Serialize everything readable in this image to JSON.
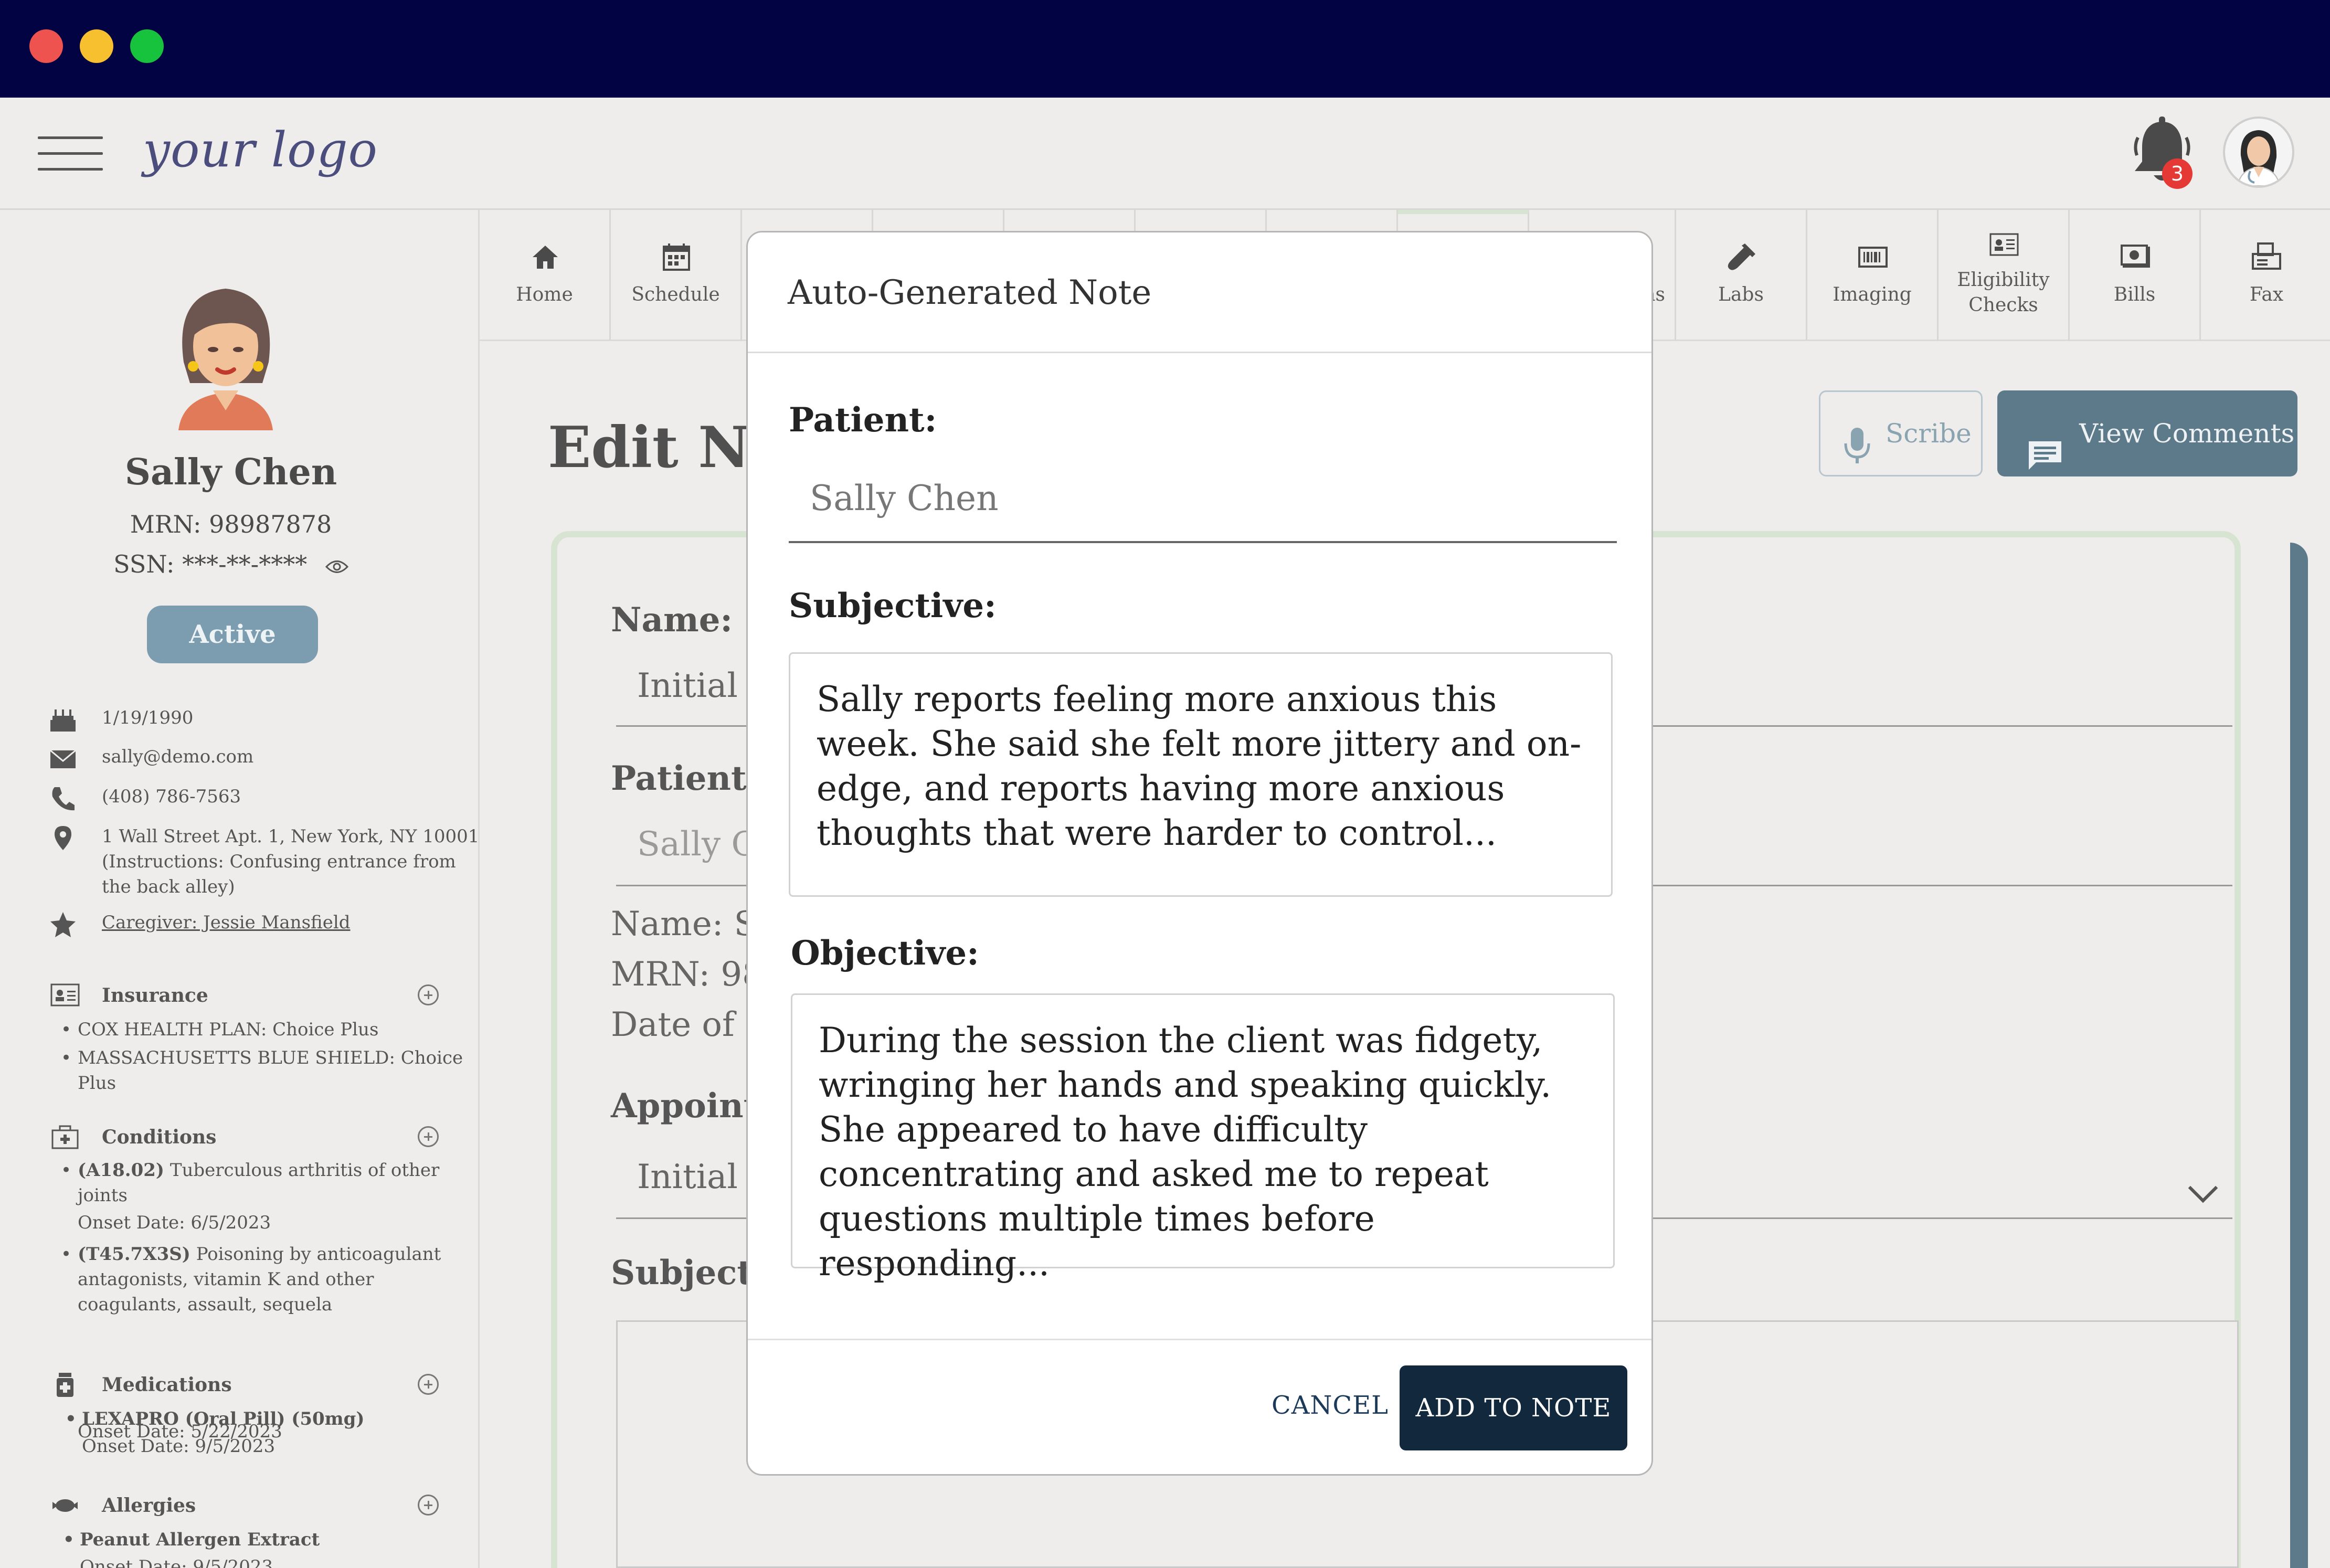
{
  "header": {
    "logo": "your logo",
    "notifications_count": "3"
  },
  "patient": {
    "name": "Sally Chen",
    "mrn": "MRN: 98987878",
    "ssn": "SSN: ***-**-****",
    "status": "Active",
    "dob": "1/19/1990",
    "email": "sally@demo.com",
    "phone": "(408) 786-7563",
    "address": "1 Wall Street Apt. 1, New York, NY 10001 (Instructions: Confusing entrance from the back alley)",
    "caregiver": "Caregiver: Jessie Mansfield"
  },
  "sections": {
    "insurance": {
      "title": "Insurance",
      "items": [
        "COX HEALTH PLAN: Choice Plus",
        "MASSACHUSETTS BLUE SHIELD: Choice Plus"
      ]
    },
    "conditions": {
      "title": "Conditions",
      "items": [
        {
          "code": "(A18.02)",
          "text": "Tuberculous arthritis of other joints",
          "onset": "Onset Date: 6/5/2023"
        },
        {
          "code": "(T45.7X3S)",
          "text": "Poisoning by anticoagulant antagonists, vitamin K and other coagulants, assault, sequela",
          "onset": "Onset Date: 5/22/2023"
        }
      ]
    },
    "medications": {
      "title": "Medications",
      "items": [
        {
          "text": "LEXAPRO (Oral Pill) (50mg)",
          "onset": "Onset Date: 9/5/2023"
        }
      ]
    },
    "allergies": {
      "title": "Allergies",
      "items": [
        {
          "text": "Peanut Allergen Extract",
          "onset": "Onset Date: 9/5/2023"
        }
      ]
    }
  },
  "tabs": [
    {
      "label": "Home",
      "icon": "home-icon"
    },
    {
      "label": "Schedule",
      "icon": "calendar-icon"
    },
    {
      "label": "ns",
      "icon": ""
    },
    {
      "label": "Labs",
      "icon": "test-tube-icon"
    },
    {
      "label": "Imaging",
      "icon": "barcode-icon"
    },
    {
      "label": "Eligibility Checks",
      "icon": "id-card-icon"
    },
    {
      "label": "Bills",
      "icon": "bill-icon"
    },
    {
      "label": "Fax",
      "icon": "fax-icon"
    }
  ],
  "main": {
    "title": "Edit Note",
    "scribe_label": "Scribe",
    "comments_label": "View Comments",
    "name_label": "Name:",
    "name_value": "Initial Assessment",
    "patient_label": "Patient:",
    "patient_value": "Sally Chen",
    "info_name": "Name: Sally Chen",
    "info_mrn": "MRN: 98987878",
    "info_dob": "Date of Birth",
    "appointment_label": "Appointment:",
    "appointment_value": "Initial Assessment",
    "subjective_label": "Subjective:"
  },
  "modal": {
    "title": "Auto-Generated Note",
    "patient_label": "Patient:",
    "patient_value": "Sally Chen",
    "subjective_label": "Subjective:",
    "subjective_text": "Sally reports feeling more anxious this week. She said she felt more jittery and on-edge, and reports having more anxious thoughts that were harder to control...",
    "objective_label": "Objective:",
    "objective_text": "During the session the client was fidgety, wringing her hands and speaking quickly. She appeared to have difficulty concentrating and asked me to repeat questions multiple times before responding...",
    "cancel_label": "CANCEL",
    "add_label": "ADD TO NOTE"
  },
  "colors": {
    "titlebar": "#020342",
    "accent_button": "#5d7a8a",
    "status_badge": "#7c9db0",
    "primary_action": "#12283d",
    "card_border": "#d8e4d2"
  }
}
